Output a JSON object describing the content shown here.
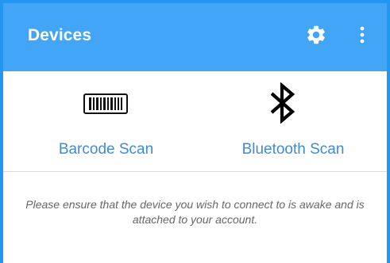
{
  "app": {
    "title": "Devices",
    "accent_color": "#42a5f5",
    "link_color": "#3f8bd1"
  },
  "toolbar": {
    "settings_icon": "gear-icon",
    "overflow_icon": "more-vertical-icon"
  },
  "options": [
    {
      "label": "Barcode Scan",
      "icon": "barcode-icon"
    },
    {
      "label": "Bluetooth Scan",
      "icon": "bluetooth-icon"
    }
  ],
  "notice": {
    "text": "Please ensure that the device you wish to connect to is awake and is attached to your account."
  }
}
